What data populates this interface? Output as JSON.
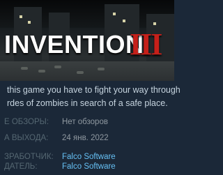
{
  "capsule": {
    "title_word": "INVENTION",
    "title_numeral": "III"
  },
  "description": {
    "line1": "this game you have to fight your way through",
    "line2": "rdes of zombies in search of a safe place."
  },
  "meta": {
    "reviews_label": "Е ОБЗОРЫ:",
    "reviews_value": "Нет обзоров",
    "release_label": "А ВЫХОДА:",
    "release_value": "24 янв. 2022",
    "developer_label": "ЗРАБОТЧИК:",
    "developer_value": "Falco Software",
    "publisher_label": "ДАТЕЛЬ:",
    "publisher_value": "Falco Software"
  },
  "colors": {
    "background": "#1b2838",
    "link": "#66c0f4",
    "title_numeral": "#c5201a"
  }
}
